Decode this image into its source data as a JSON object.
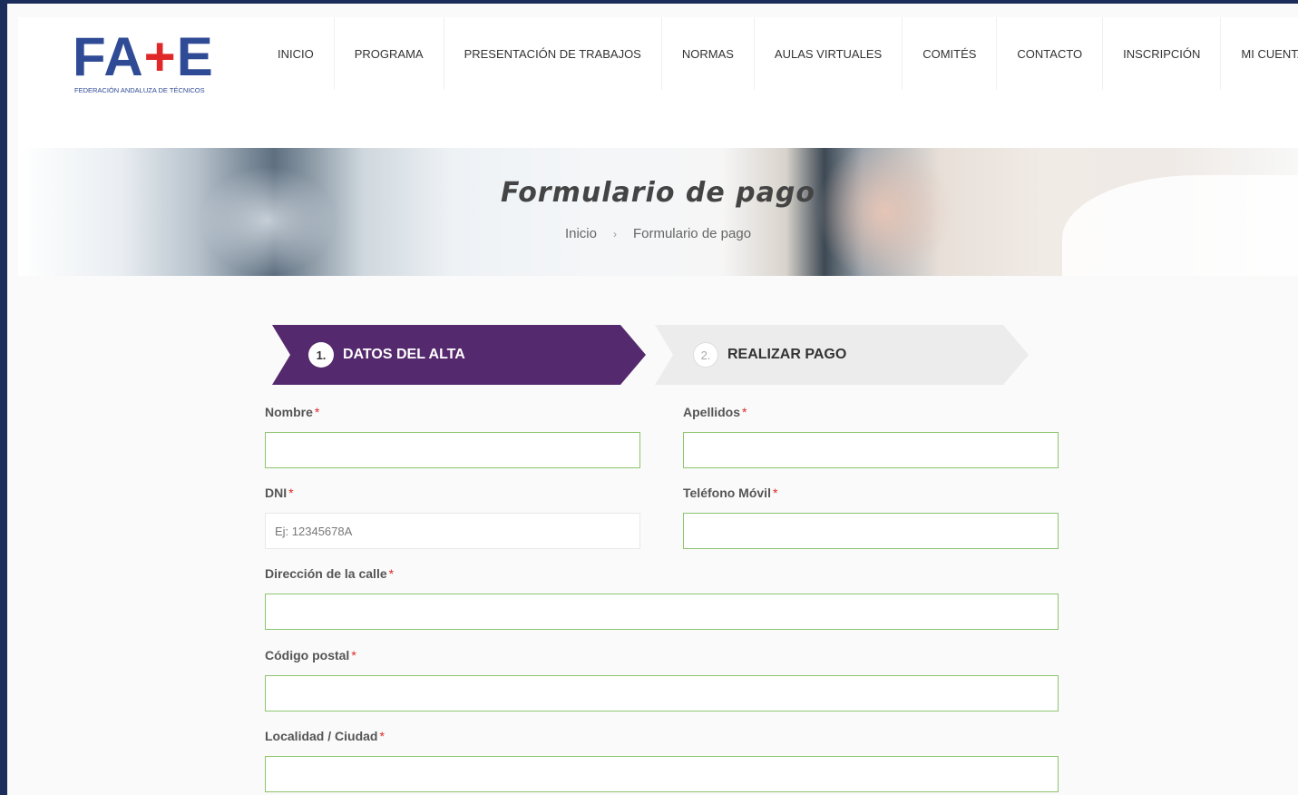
{
  "logo": {
    "letters_left": "FA",
    "plus": "+",
    "letters_right": "E",
    "subtitle": "FEDERACIÓN ANDALUZA DE TÉCNICOS"
  },
  "nav": {
    "items": [
      "INICIO",
      "PROGRAMA",
      "PRESENTACIÓN DE TRABAJOS",
      "NORMAS",
      "AULAS VIRTUALES",
      "COMITÉS",
      "CONTACTO",
      "INSCRIPCIÓN",
      "MI CUENTA"
    ]
  },
  "banner": {
    "title": "Formulario de pago",
    "breadcrumb_home": "Inicio",
    "breadcrumb_sep": "›",
    "breadcrumb_current": "Formulario de pago"
  },
  "steps": [
    {
      "number": "1.",
      "label": "DATOS DEL ALTA",
      "active": true
    },
    {
      "number": "2.",
      "label": "REALIZAR PAGO",
      "active": false
    }
  ],
  "form": {
    "required_mark": "*",
    "nombre": {
      "label": "Nombre",
      "value": "",
      "placeholder": ""
    },
    "apellidos": {
      "label": "Apellidos",
      "value": "",
      "placeholder": ""
    },
    "dni": {
      "label": "DNI",
      "value": "",
      "placeholder": "Ej: 12345678A"
    },
    "telefono": {
      "label": "Teléfono Móvil",
      "value": "",
      "placeholder": ""
    },
    "direccion": {
      "label": "Dirección de la calle",
      "value": "",
      "placeholder": ""
    },
    "codigo_postal": {
      "label": "Código postal",
      "value": "",
      "placeholder": ""
    },
    "localidad": {
      "label": "Localidad / Ciudad",
      "value": "",
      "placeholder": ""
    }
  },
  "colors": {
    "brand_blue": "#2f4b95",
    "brand_red": "#e02828",
    "step_active": "#55296d",
    "step_inactive": "#ececec",
    "input_valid_border": "#8dc46f"
  }
}
